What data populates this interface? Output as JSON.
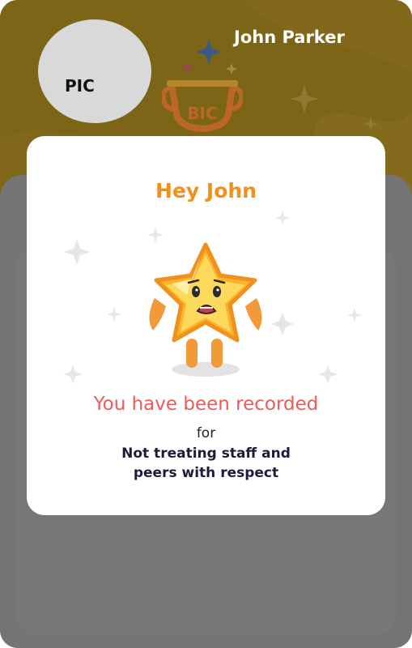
{
  "header": {
    "avatar_label": "PIC",
    "user_name": "John Parker",
    "badge_text": "BIC"
  },
  "card": {
    "greeting": "Hey John",
    "headline": "You have been recorded",
    "connector": "for",
    "reason_lines": [
      "Not treating staff and",
      "peers with respect"
    ]
  },
  "icons": {
    "mascot": "sad-star-icon",
    "sparkles": "sparkle-icon",
    "trophy": "trophy-icon"
  },
  "colors": {
    "banner": "#7d6518",
    "greeting": "#f2901e",
    "headline": "#ee5a5a",
    "reason": "#1c1c3a",
    "overlay": "#747474"
  }
}
